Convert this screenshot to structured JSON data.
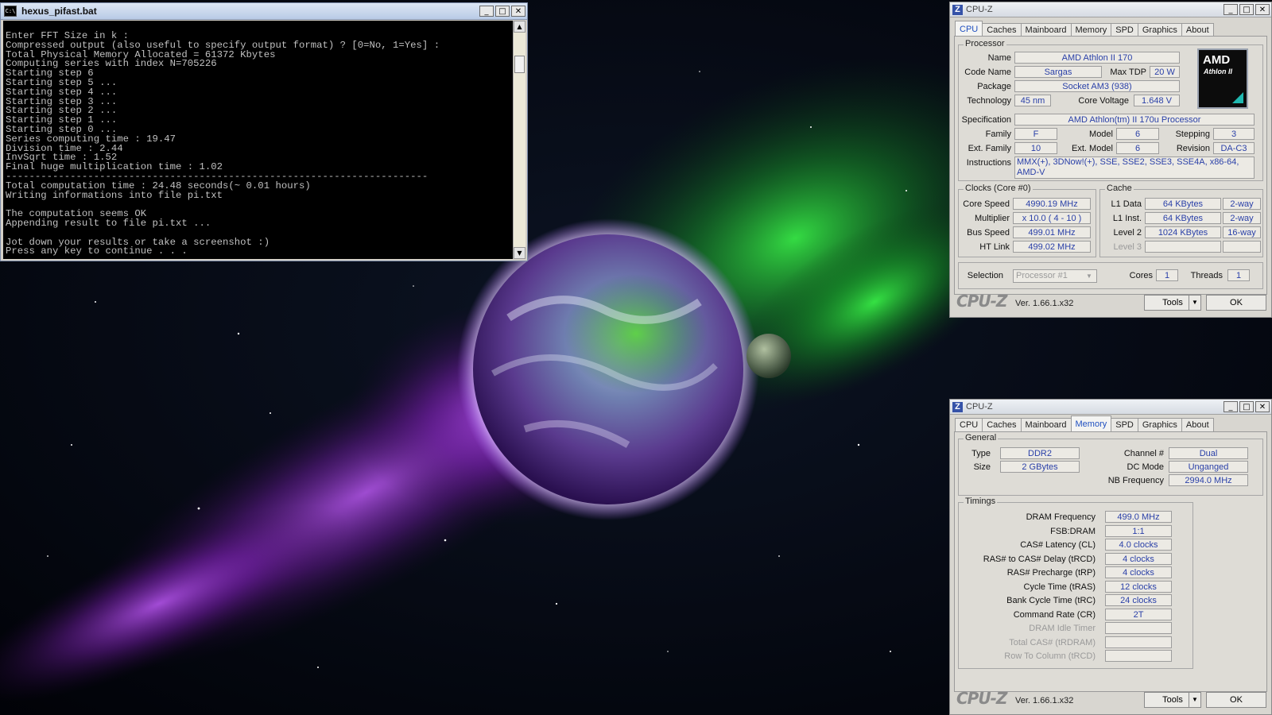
{
  "console": {
    "title": "hexus_pifast.bat",
    "lines": [
      "Enter FFT Size in k :",
      "Compressed output (also useful to specify output format) ? [0=No, 1=Yes] :",
      "Total Physical Memory Allocated = 61372 Kbytes",
      "Computing series with index N=705226",
      "Starting step 6",
      "Starting step 5 ...",
      "Starting step 4 ...",
      "Starting step 3 ...",
      "Starting step 2 ...",
      "Starting step 1 ...",
      "Starting step 0 ...",
      "Series computing time : 19.47",
      "Division time : 2.44",
      "InvSqrt time : 1.52",
      "Final huge multiplication time : 1.02",
      "------------------------------------------------------------------------",
      "Total computation time : 24.48 seconds(~ 0.01 hours)",
      "Writing informations into file pi.txt",
      "",
      "The computation seems OK",
      "Appending result to file pi.txt ...",
      "",
      "Jot down your results or take a screenshot :)",
      "Press any key to continue . . ."
    ]
  },
  "cpuz_cpu": {
    "title": "CPU-Z",
    "tabs": [
      "CPU",
      "Caches",
      "Mainboard",
      "Memory",
      "SPD",
      "Graphics",
      "About"
    ],
    "active_tab": "CPU",
    "processor": {
      "group": "Processor",
      "name_label": "Name",
      "name": "AMD Athlon II 170",
      "codename_label": "Code Name",
      "codename": "Sargas",
      "maxtdp_label": "Max TDP",
      "maxtdp": "20 W",
      "package_label": "Package",
      "package": "Socket AM3 (938)",
      "technology_label": "Technology",
      "technology": "45 nm",
      "corevoltage_label": "Core Voltage",
      "corevoltage": "1.648 V",
      "spec_label": "Specification",
      "spec": "AMD Athlon(tm) II 170u Processor",
      "family_label": "Family",
      "family": "F",
      "model_label": "Model",
      "model": "6",
      "stepping_label": "Stepping",
      "stepping": "3",
      "extfamily_label": "Ext. Family",
      "extfamily": "10",
      "extmodel_label": "Ext. Model",
      "extmodel": "6",
      "revision_label": "Revision",
      "revision": "DA-C3",
      "instructions_label": "Instructions",
      "instructions": "MMX(+), 3DNow!(+), SSE, SSE2, SSE3, SSE4A, x86-64, AMD-V",
      "logo_brand": "AMD",
      "logo_sub": "Athlon II"
    },
    "clocks": {
      "group": "Clocks (Core #0)",
      "corespeed_label": "Core Speed",
      "corespeed": "4990.19 MHz",
      "multiplier_label": "Multiplier",
      "multiplier": "x 10.0 ( 4 - 10 )",
      "busspeed_label": "Bus Speed",
      "busspeed": "499.01 MHz",
      "htlink_label": "HT Link",
      "htlink": "499.02 MHz"
    },
    "cache": {
      "group": "Cache",
      "l1data_label": "L1 Data",
      "l1data": "64 KBytes",
      "l1data_way": "2-way",
      "l1inst_label": "L1 Inst.",
      "l1inst": "64 KBytes",
      "l1inst_way": "2-way",
      "level2_label": "Level 2",
      "level2": "1024 KBytes",
      "level2_way": "16-way",
      "level3_label": "Level 3"
    },
    "selection_label": "Selection",
    "selection": "Processor #1",
    "cores_label": "Cores",
    "cores": "1",
    "threads_label": "Threads",
    "threads": "1",
    "footer_brand": "CPU-Z",
    "version": "Ver. 1.66.1.x32",
    "tools_label": "Tools",
    "ok_label": "OK"
  },
  "cpuz_mem": {
    "title": "CPU-Z",
    "tabs": [
      "CPU",
      "Caches",
      "Mainboard",
      "Memory",
      "SPD",
      "Graphics",
      "About"
    ],
    "active_tab": "Memory",
    "general": {
      "group": "General",
      "type_label": "Type",
      "type": "DDR2",
      "size_label": "Size",
      "size": "2 GBytes",
      "channel_label": "Channel #",
      "channel": "Dual",
      "dcmode_label": "DC Mode",
      "dcmode": "Unganged",
      "nbfreq_label": "NB Frequency",
      "nbfreq": "2994.0 MHz"
    },
    "timings": {
      "group": "Timings",
      "rows": [
        {
          "label": "DRAM Frequency",
          "value": "499.0 MHz"
        },
        {
          "label": "FSB:DRAM",
          "value": "1:1"
        },
        {
          "label": "CAS# Latency (CL)",
          "value": "4.0 clocks"
        },
        {
          "label": "RAS# to CAS# Delay (tRCD)",
          "value": "4 clocks"
        },
        {
          "label": "RAS# Precharge (tRP)",
          "value": "4 clocks"
        },
        {
          "label": "Cycle Time (tRAS)",
          "value": "12 clocks"
        },
        {
          "label": "Bank Cycle Time (tRC)",
          "value": "24 clocks"
        },
        {
          "label": "Command Rate (CR)",
          "value": "2T"
        },
        {
          "label": "DRAM Idle Timer",
          "value": ""
        },
        {
          "label": "Total CAS# (tRDRAM)",
          "value": ""
        },
        {
          "label": "Row To Column (tRCD)",
          "value": ""
        }
      ]
    },
    "footer_brand": "CPU-Z",
    "version": "Ver. 1.66.1.x32",
    "tools_label": "Tools",
    "ok_label": "OK"
  }
}
